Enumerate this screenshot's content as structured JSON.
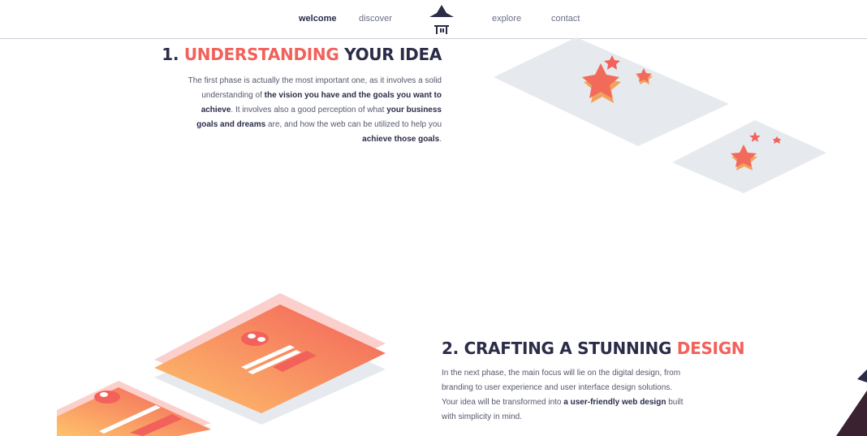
{
  "nav": {
    "welcome": "welcome",
    "discover": "discover",
    "explore": "explore",
    "contact": "contact"
  },
  "section1": {
    "number": "1.",
    "accent": "UNDERSTANDING",
    "rest": "YOUR IDEA",
    "text_1": "The first phase is actually the most important one, as it involves a solid understanding of ",
    "bold_1": "the vision you have and the goals you want to achieve",
    "text_2": ". It involves also a good perception of what ",
    "bold_2": "your business goals and dreams",
    "text_3": " are, and how the web can be utilized to help you ",
    "bold_3": "achieve those goals",
    "text_4": "."
  },
  "section2": {
    "title_main": "2. CRAFTING A STUNNING",
    "accent": "DESIGN",
    "text_1": "In the next phase, the main focus will lie on the digital design, from branding to user experience and user interface design solutions. Your idea will be transformed into ",
    "bold_1": "a user-friendly web design",
    "text_2": " built with simplicity in mind."
  },
  "colors": {
    "accent": "#f2615a",
    "navy": "#2a2c48",
    "plane": "#e6e9ed",
    "gradient_start": "#fec26b",
    "gradient_end": "#f2615a"
  },
  "icons": {
    "logo": "pagoda-logo-icon",
    "star": "star-icon"
  }
}
